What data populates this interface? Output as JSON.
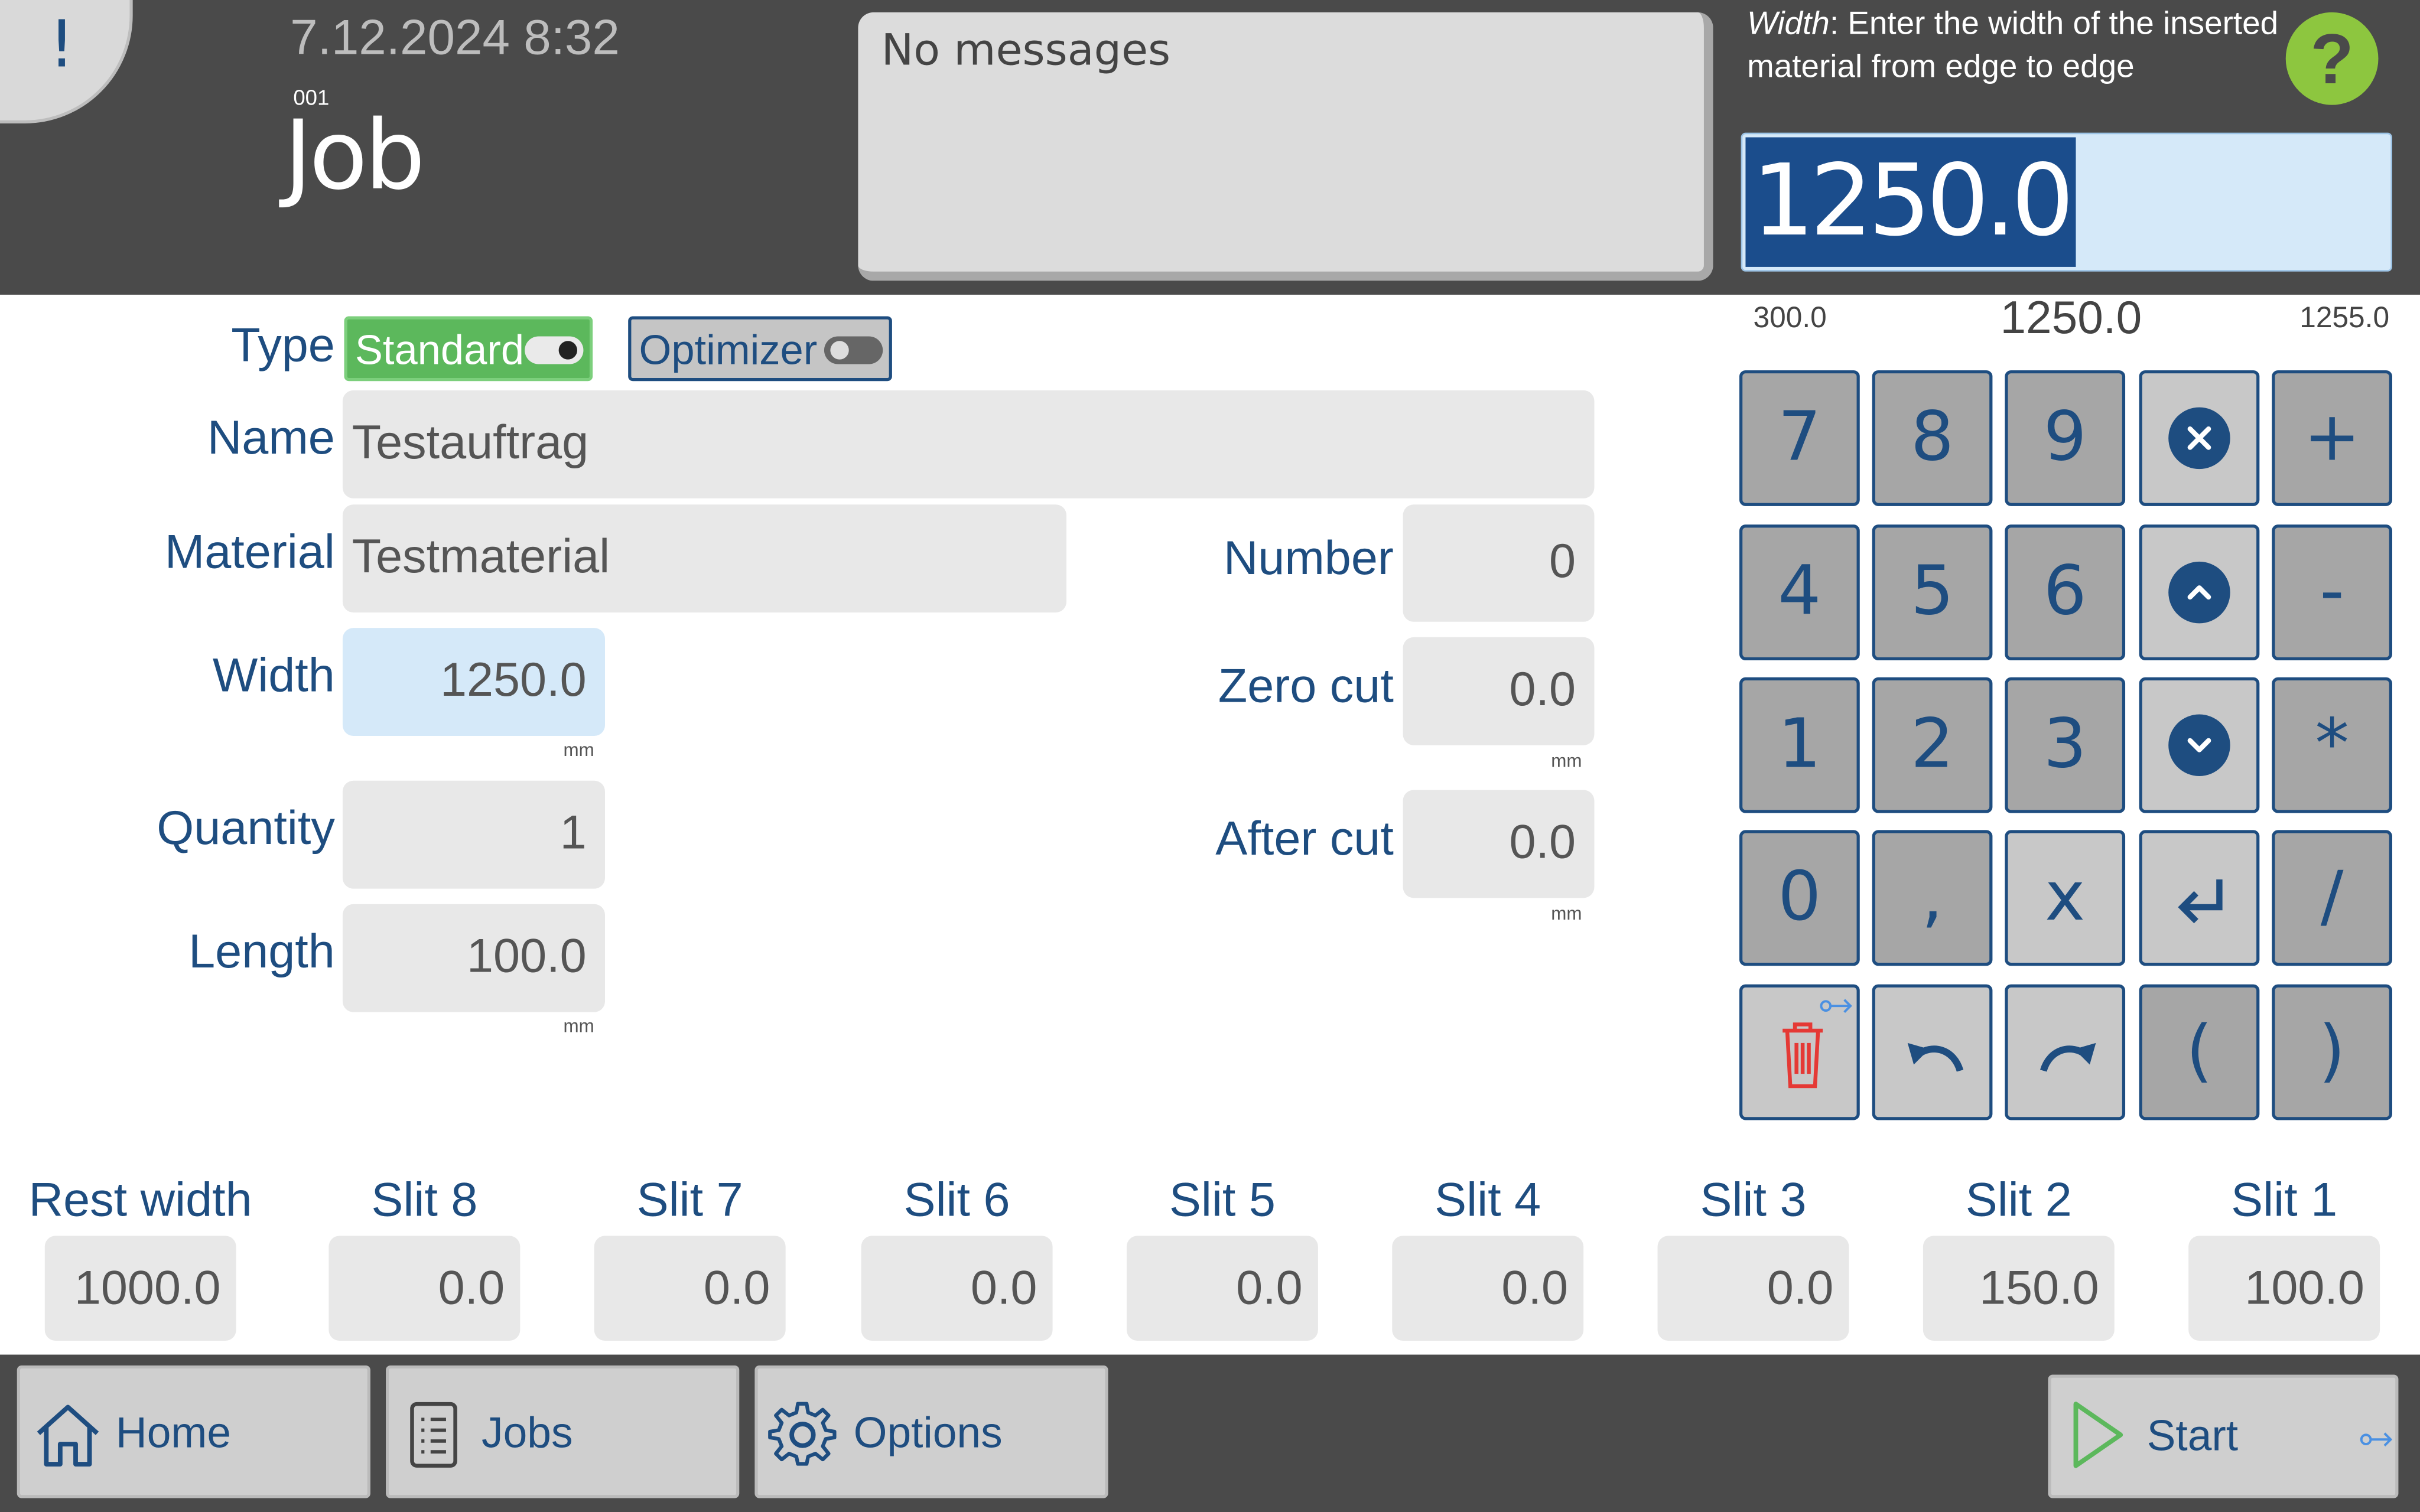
{
  "header": {
    "alert_symbol": "!",
    "datetime": "7.12.2024 8:32",
    "job_number": "001",
    "title": "Job",
    "messages": "No messages",
    "help": {
      "field_name": "Width",
      "text": ": Enter the width of the inserted material from edge to edge",
      "button_symbol": "?"
    },
    "entry": {
      "value": "1250.0",
      "min": "300.0",
      "current": "1250.0",
      "max": "1255.0"
    }
  },
  "form": {
    "type": {
      "label": "Type",
      "standard": "Standard",
      "standard_on": true,
      "optimizer": "Optimizer",
      "optimizer_on": false
    },
    "name": {
      "label": "Name",
      "value": "Testauftrag"
    },
    "material": {
      "label": "Material",
      "value": "Testmaterial"
    },
    "width": {
      "label": "Width",
      "value": "1250.0",
      "unit": "mm"
    },
    "quantity": {
      "label": "Quantity",
      "value": "1"
    },
    "length": {
      "label": "Length",
      "value": "100.0",
      "unit": "mm"
    },
    "number": {
      "label": "Number",
      "value": "0"
    },
    "zero_cut": {
      "label": "Zero cut",
      "value": "0.0",
      "unit": "mm"
    },
    "after_cut": {
      "label": "After cut",
      "value": "0.0",
      "unit": "mm"
    }
  },
  "keypad": {
    "keys": [
      "7",
      "8",
      "9",
      "+",
      "4",
      "5",
      "6",
      "-",
      "1",
      "2",
      "3",
      "*",
      "0",
      ",",
      "x",
      "/",
      "(",
      ")"
    ],
    "icons": [
      "clear-icon",
      "up-icon",
      "down-icon",
      "enter-icon",
      "delete-icon",
      "undo-icon",
      "redo-icon"
    ]
  },
  "slits": [
    {
      "label": "Rest width",
      "value": "1000.0"
    },
    {
      "label": "Slit 8",
      "value": "0.0"
    },
    {
      "label": "Slit 7",
      "value": "0.0"
    },
    {
      "label": "Slit 6",
      "value": "0.0"
    },
    {
      "label": "Slit 5",
      "value": "0.0"
    },
    {
      "label": "Slit 4",
      "value": "0.0"
    },
    {
      "label": "Slit 3",
      "value": "0.0"
    },
    {
      "label": "Slit 2",
      "value": "150.0"
    },
    {
      "label": "Slit 1",
      "value": "100.0"
    }
  ],
  "footer": {
    "home": "Home",
    "jobs": "Jobs",
    "options": "Options",
    "start": "Start"
  },
  "colors": {
    "header_bg": "#4a4a4a",
    "label_blue": "#1e4d80",
    "selection_blue": "#1b4d8c",
    "highlight": "#d5e9f9",
    "toggle_green": "#5cb85c",
    "help_green": "#8dc63f",
    "delete_red": "#e53935"
  }
}
